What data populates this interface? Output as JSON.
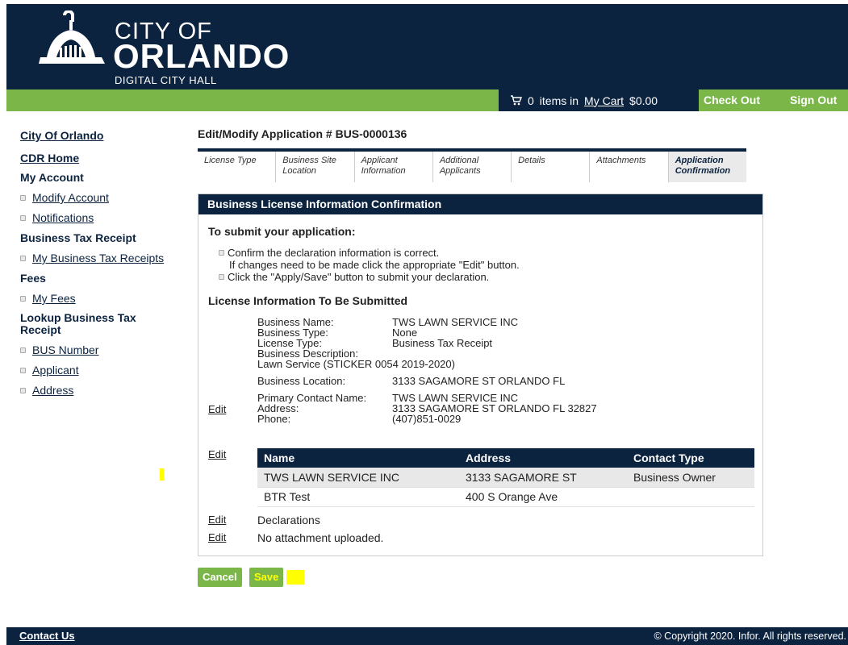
{
  "header": {
    "logo_city": "CITY OF",
    "logo_orlando": "ORLANDO",
    "logo_sub": "DIGITAL CITY HALL",
    "brand_color": "#0c2340",
    "accent_color": "#7ab648"
  },
  "topbar": {
    "cart_count": "0",
    "cart_items_text": "items in",
    "cart_link": "My Cart",
    "cart_total": "$0.00",
    "checkout": "Check Out",
    "signout": "Sign Out"
  },
  "sidebar": {
    "city": "City Of Orlando",
    "cdr": "CDR Home",
    "my_account": "My Account",
    "modify_account": "Modify Account",
    "notifications": "Notifications",
    "btr_head": "Business Tax Receipt",
    "my_btr": "My Business Tax Receipts",
    "fees_head": "Fees",
    "my_fees": "My Fees",
    "lookup_head": "Lookup Business Tax Receipt",
    "bus_number": "BUS Number",
    "applicant": "Applicant",
    "address": "Address"
  },
  "main": {
    "title": "Edit/Modify Application # BUS-0000136",
    "tabs": [
      {
        "label": "License Type"
      },
      {
        "label": "Business Site Location"
      },
      {
        "label": "Applicant Information"
      },
      {
        "label": "Additional Applicants"
      },
      {
        "label": "Details"
      },
      {
        "label": "Attachments"
      },
      {
        "label": "Application Confirmation"
      }
    ],
    "panel_title": "Business License Information Confirmation",
    "submit_title": "To submit your application:",
    "instr1": "Confirm the declaration information is correct.",
    "instr2": "If changes need to be made click the appropriate \"Edit\" button.",
    "instr3": "Click the \"Apply/Save\" button to submit your declaration.",
    "lic_title": "License Information To Be Submitted",
    "business_name_label": "Business Name:",
    "business_name": "TWS LAWN SERVICE INC",
    "business_type_label": "Business Type:",
    "business_type": "None",
    "license_type_label": "License Type:",
    "license_type": "Business Tax Receipt",
    "business_desc_label": "Business Description:",
    "business_desc": "Lawn Service (STICKER 0054 2019-2020)",
    "business_location_label": "Business Location:",
    "business_location": "3133 SAGAMORE ST ORLANDO FL",
    "primary_contact_label": "Primary Contact Name:",
    "primary_contact": "TWS LAWN SERVICE INC",
    "address_label": "Address:",
    "address": "3133 SAGAMORE ST ORLANDO FL 32827",
    "phone_label": "Phone:",
    "phone": "(407)851-0029",
    "edit": "Edit",
    "contacts_table": {
      "headers": [
        "Name",
        "Address",
        "Contact Type"
      ],
      "rows": [
        [
          "TWS LAWN SERVICE INC",
          "3133 SAGAMORE ST",
          "Business Owner"
        ],
        [
          "BTR Test",
          "400 S Orange Ave",
          ""
        ]
      ]
    },
    "declarations": "Declarations",
    "attachments": "No attachment uploaded.",
    "cancel": "Cancel",
    "save": "Save"
  },
  "footer": {
    "contact": "Contact Us",
    "copyright": "© Copyright 2020. Infor. All rights reserved."
  }
}
